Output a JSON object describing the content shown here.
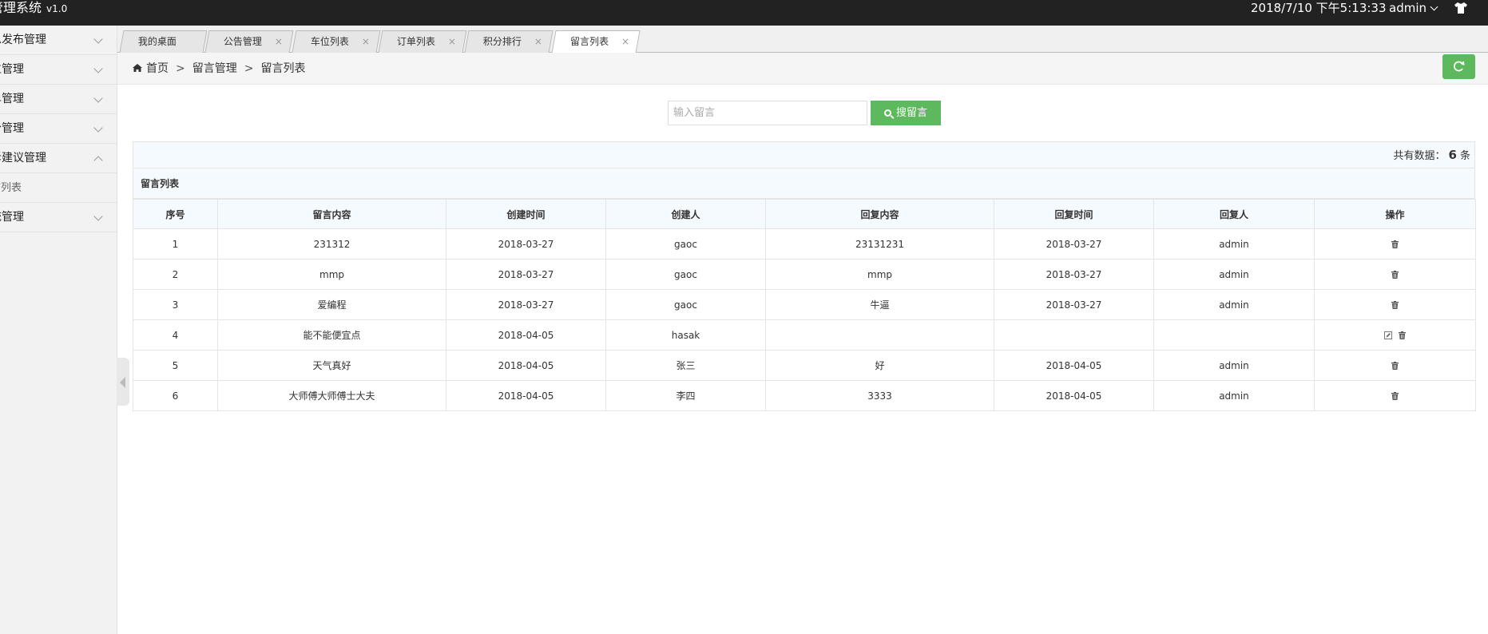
{
  "app": {
    "title": "管理系统",
    "version": "v1.0"
  },
  "header": {
    "datetime": "2018/7/10 下午5:13:33",
    "user": "admin"
  },
  "sidebar": {
    "items": [
      {
        "label": "息发布管理",
        "expanded": false
      },
      {
        "label": "位管理",
        "expanded": false
      },
      {
        "label": "单管理",
        "expanded": false
      },
      {
        "label": "分管理",
        "expanded": false
      },
      {
        "label": "诉建议管理",
        "expanded": true
      },
      {
        "label": "统管理",
        "expanded": false
      }
    ],
    "sub_item": "言列表"
  },
  "tabs": [
    {
      "label": "我的桌面"
    },
    {
      "label": "公告管理",
      "close": "×"
    },
    {
      "label": "车位列表",
      "close": "×"
    },
    {
      "label": "订单列表",
      "close": "×"
    },
    {
      "label": "积分排行",
      "close": "×"
    },
    {
      "label": "留言列表",
      "close": "×",
      "active": true
    }
  ],
  "breadcrumb": {
    "home": "首页",
    "sep": ">",
    "level1": "留言管理",
    "level2": "留言列表"
  },
  "search": {
    "placeholder": "输入留言",
    "button": "搜留言"
  },
  "count": {
    "prefix": "共有数据：",
    "value": "6",
    "suffix": "条"
  },
  "table": {
    "title": "留言列表",
    "headers": [
      "序号",
      "留言内容",
      "创建时间",
      "创建人",
      "回复内容",
      "回复时间",
      "回复人",
      "操作"
    ],
    "rows": [
      {
        "id": "1",
        "content": "231312",
        "created": "2018-03-27",
        "creator": "gaoc",
        "reply": "23131231",
        "reply_time": "2018-03-27",
        "replier": "admin",
        "editable": false
      },
      {
        "id": "2",
        "content": "mmp",
        "created": "2018-03-27",
        "creator": "gaoc",
        "reply": "mmp",
        "reply_time": "2018-03-27",
        "replier": "admin",
        "editable": false
      },
      {
        "id": "3",
        "content": "爱编程",
        "created": "2018-03-27",
        "creator": "gaoc",
        "reply": "牛逼",
        "reply_time": "2018-03-27",
        "replier": "admin",
        "editable": false
      },
      {
        "id": "4",
        "content": "能不能便宜点",
        "created": "2018-04-05",
        "creator": "hasak",
        "reply": "",
        "reply_time": "",
        "replier": "",
        "editable": true
      },
      {
        "id": "5",
        "content": "天气真好",
        "created": "2018-04-05",
        "creator": "张三",
        "reply": "好",
        "reply_time": "2018-04-05",
        "replier": "admin",
        "editable": false
      },
      {
        "id": "6",
        "content": "大师傅大师傅士大夫",
        "created": "2018-04-05",
        "creator": "李四",
        "reply": "3333",
        "reply_time": "2018-04-05",
        "replier": "admin",
        "editable": false
      }
    ]
  },
  "colors": {
    "topbar": "#222222",
    "accent_green": "#5eb95e",
    "table_header": "#f5fafe"
  }
}
